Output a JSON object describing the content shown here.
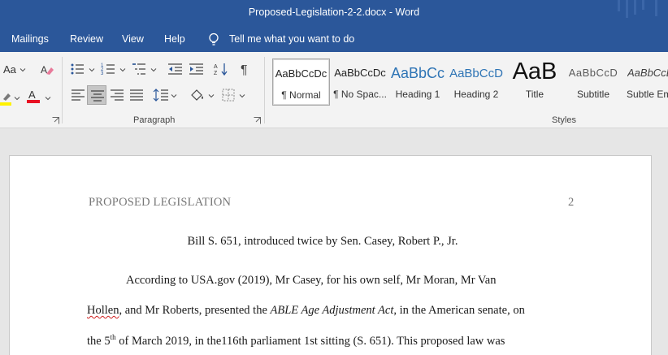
{
  "window": {
    "title": "Proposed-Legislation-2-2.docx  -  Word"
  },
  "menu": {
    "items": [
      "Mailings",
      "Review",
      "View",
      "Help"
    ],
    "tell_me": "Tell me what you want to do"
  },
  "ribbon": {
    "font": {
      "case_label": "Aa"
    },
    "paragraph_label": "Paragraph",
    "styles_label": "Styles",
    "colors": {
      "highlight": "#fff200",
      "font_color": "#e81123",
      "accent": "#2b579a"
    },
    "styles": [
      {
        "sample": "AaBbCcDc",
        "name": "¶ Normal"
      },
      {
        "sample": "AaBbCcDc",
        "name": "¶ No Spac..."
      },
      {
        "sample": "AaBbCc",
        "name": "Heading 1"
      },
      {
        "sample": "AaBbCcD",
        "name": "Heading 2"
      },
      {
        "sample": "AaB",
        "name": "Title"
      },
      {
        "sample": "AaBbCcD",
        "name": "Subtitle"
      },
      {
        "sample": "AaBbCcDd",
        "name": "Subtle Em..."
      }
    ]
  },
  "document": {
    "header_left": "PROPOSED LEGISLATION",
    "page_number": "2",
    "title": "Bill S. 651, introduced twice by Sen. Casey, Robert P., Jr.",
    "line1": "According to USA.gov (2019), Mr Casey, for his own self, Mr Moran, Mr Van",
    "line2_a": "Hollen",
    "line2_b": ", and Mr Roberts, presented the ",
    "line2_italic": "ABLE Age Adjustment Act",
    "line2_c": ", in the American senate, on",
    "line3_a": "the 5",
    "line3_sup": "th",
    "line3_b": " of March 2019, in the116th parliament 1st sitting (S. 651). This proposed law was"
  }
}
